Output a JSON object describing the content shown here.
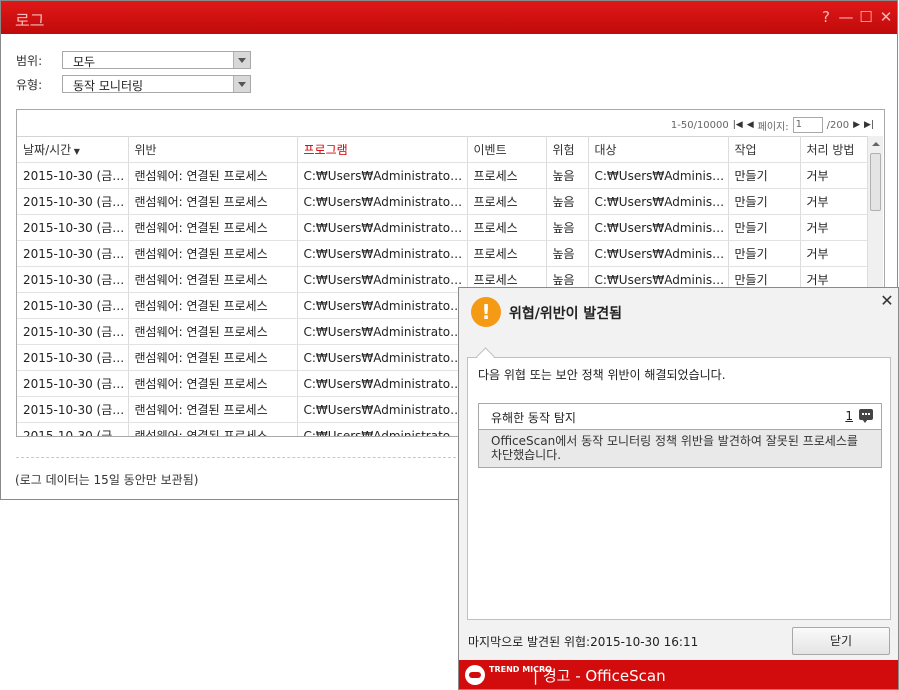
{
  "window": {
    "title": "로그"
  },
  "filters": {
    "scope_label": "범위:",
    "scope_value": "모두",
    "type_label": "유형:",
    "type_value": "동작 모니터링"
  },
  "pager": {
    "range": "1-50/10000",
    "page_label": "페이지:",
    "page_value": "1",
    "total": "/200"
  },
  "columns": [
    "날짜/시간",
    "위반",
    "프로그램",
    "이벤트",
    "위험",
    "대상",
    "작업",
    "처리 방법"
  ],
  "rows": [
    [
      "2015-10-30 (금) …",
      "랜섬웨어: 연결된 프로세스",
      "C:₩Users₩Administrator,…",
      "프로세스",
      "높음",
      "C:₩Users₩Administr,…",
      "만들기",
      "거부"
    ],
    [
      "2015-10-30 (금) …",
      "랜섬웨어: 연결된 프로세스",
      "C:₩Users₩Administrator,…",
      "프로세스",
      "높음",
      "C:₩Users₩Administr,…",
      "만들기",
      "거부"
    ],
    [
      "2015-10-30 (금) …",
      "랜섬웨어: 연결된 프로세스",
      "C:₩Users₩Administrator,…",
      "프로세스",
      "높음",
      "C:₩Users₩Administr,…",
      "만들기",
      "거부"
    ],
    [
      "2015-10-30 (금) …",
      "랜섬웨어: 연결된 프로세스",
      "C:₩Users₩Administrator,…",
      "프로세스",
      "높음",
      "C:₩Users₩Administr,…",
      "만들기",
      "거부"
    ],
    [
      "2015-10-30 (금) …",
      "랜섬웨어: 연결된 프로세스",
      "C:₩Users₩Administrator,…",
      "프로세스",
      "높음",
      "C:₩Users₩Administr,…",
      "만들기",
      "거부"
    ],
    [
      "2015-10-30 (금) …",
      "랜섬웨어: 연결된 프로세스",
      "C:₩Users₩Administrator,…",
      "",
      "",
      "",
      "",
      ""
    ],
    [
      "2015-10-30 (금) …",
      "랜섬웨어: 연결된 프로세스",
      "C:₩Users₩Administrator,…",
      "",
      "",
      "",
      "",
      ""
    ],
    [
      "2015-10-30 (금) …",
      "랜섬웨어: 연결된 프로세스",
      "C:₩Users₩Administrator,…",
      "",
      "",
      "",
      "",
      ""
    ],
    [
      "2015-10-30 (금) …",
      "랜섬웨어: 연결된 프로세스",
      "C:₩Users₩Administrator,…",
      "",
      "",
      "",
      "",
      ""
    ],
    [
      "2015-10-30 (금) …",
      "랜섬웨어: 연결된 프로세스",
      "C:₩Users₩Administrator,…",
      "",
      "",
      "",
      "",
      ""
    ],
    [
      "2015-10-30 (금) …",
      "랜섬웨어: 연결된 프로세스",
      "C:₩Users₩Administrator,…",
      "",
      "",
      "",
      "",
      ""
    ]
  ],
  "note": "(로그 데이터는 15일 동안만 보관됨)",
  "popup": {
    "title": "위협/위반이 발견됨",
    "message": "다음 위협 또는 보안 정책 위반이 해결되었습니다.",
    "detail_label": "유해한 동작 탐지",
    "detail_count": "1",
    "detail_text": "OfficeScan에서 동작 모니터링 정책 위반을 발견하여 잘못된 프로세스를 차단했습니다.",
    "last_found": "마지막으로 발견된 위협:2015-10-30 16:11",
    "close_label": "닫기",
    "brand": "TREND MICRO",
    "footer_text": "| 경고 - OfficeScan"
  },
  "colors": {
    "title_red": "#d20c0c",
    "active_col": "#d40000",
    "warn_orange": "#f59a15"
  }
}
